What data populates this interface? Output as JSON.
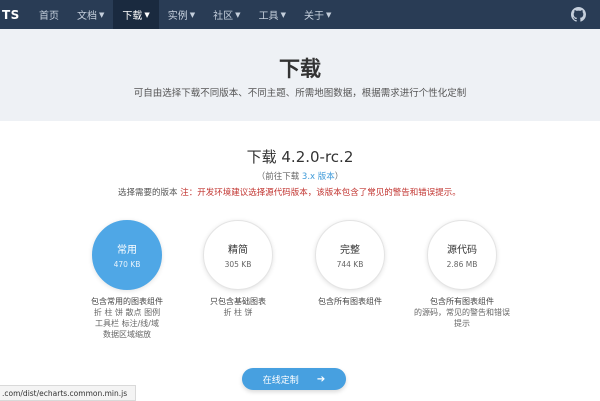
{
  "nav": {
    "brand": "TS",
    "items": [
      {
        "label": "首页",
        "caret": false,
        "active": false
      },
      {
        "label": "文档",
        "caret": true,
        "active": false
      },
      {
        "label": "下载",
        "caret": true,
        "active": true
      },
      {
        "label": "实例",
        "caret": true,
        "active": false
      },
      {
        "label": "社区",
        "caret": true,
        "active": false
      },
      {
        "label": "工具",
        "caret": true,
        "active": false
      },
      {
        "label": "关于",
        "caret": true,
        "active": false
      }
    ],
    "github_icon": "github-icon"
  },
  "hero": {
    "title": "下载",
    "subtitle": "可自由选择下载不同版本、不同主题、所需地图数据，根据需求进行个性化定制"
  },
  "main": {
    "version_title": "下载 4.2.0-rc.2",
    "prev_prefix": "（前往下载 ",
    "prev_link": "3.x 版本",
    "prev_suffix": "）",
    "notice_prefix": "选择需要的版本 ",
    "notice_warn": "注：开发环境建议选择源代码版本，该版本包含了常见的警告和错误提示。",
    "options": [
      {
        "name": "常用",
        "size": "470 KB",
        "desc1": "包含常用的图表组件",
        "desc2": [
          "折 柱 饼 散点 图例",
          "工具栏 标注/线/域",
          "数据区域缩放"
        ],
        "selected": true
      },
      {
        "name": "精简",
        "size": "305 KB",
        "desc1": "只包含基础图表",
        "desc2": [
          "折 柱 饼"
        ],
        "selected": false
      },
      {
        "name": "完整",
        "size": "744 KB",
        "desc1": "包含所有图表组件",
        "desc2": [],
        "selected": false
      },
      {
        "name": "源代码",
        "size": "2.86 MB",
        "desc1": "包含所有图表组件",
        "desc2": [
          "的源码，常见的警告和错误",
          "提示"
        ],
        "selected": false
      }
    ],
    "cta_label": "在线定制",
    "cta_arrow": "➔"
  },
  "status_url": ".com/dist/echarts.common.min.js",
  "colors": {
    "nav_bg": "#293c55",
    "accent": "#4fa7e6",
    "warning": "#c23531"
  }
}
